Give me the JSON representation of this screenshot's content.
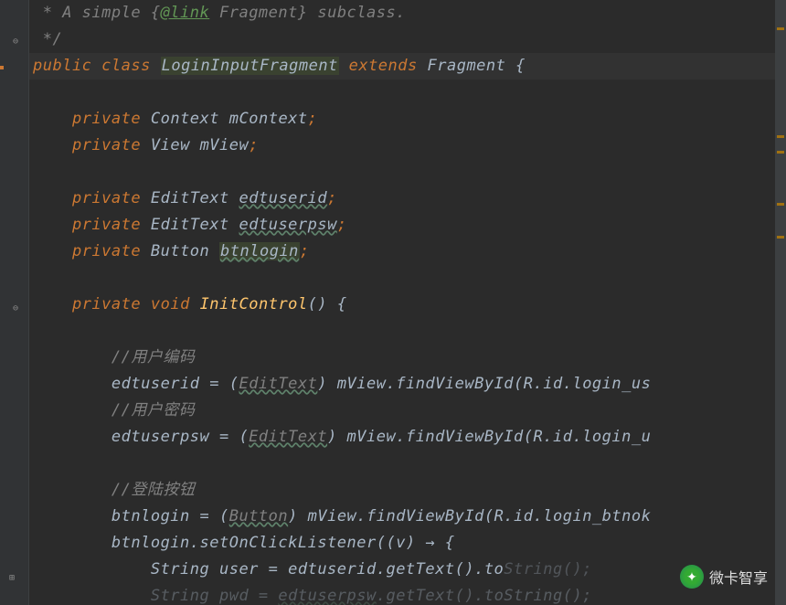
{
  "doc": {
    "line1_pre": " * A simple {",
    "link_tag": "@link",
    "line1_mid": " Fragment",
    "line1_post": "} subclass.",
    "line2": " */"
  },
  "class_decl": {
    "public": "public",
    "class_kw": "class",
    "name": "LoginInputFragment",
    "extends_kw": "extends",
    "parent": "Fragment",
    "brace": " {"
  },
  "fields": {
    "f1": {
      "mod": "private",
      "type": "Context",
      "name": "mContext",
      "semi": ";"
    },
    "f2": {
      "mod": "private",
      "type": "View",
      "name": "mView",
      "semi": ";"
    },
    "f3": {
      "mod": "private",
      "type": "EditText",
      "name": "edtuserid",
      "semi": ";"
    },
    "f4": {
      "mod": "private",
      "type": "EditText",
      "name": "edtuserpsw",
      "semi": ";"
    },
    "f5": {
      "mod": "private",
      "type": "Button",
      "name": "btnlogin",
      "semi": ";"
    }
  },
  "method": {
    "mod": "private",
    "ret": "void",
    "name": "InitControl",
    "parens": "()",
    "brace": " {"
  },
  "body": {
    "c1": "//用户编码",
    "l1_a": "edtuserid = (",
    "l1_cast": "EditText",
    "l1_b": ") mView.findViewById(R.id.",
    "l1_id": "login_us",
    "c2": "//用户密码",
    "l2_a": "edtuserpsw = (",
    "l2_cast": "EditText",
    "l2_b": ") mView.findViewById(R.id.",
    "l2_id": "login_u",
    "c3": "//登陆按钮",
    "l3_a": "btnlogin = (",
    "l3_cast": "Button",
    "l3_b": ") mView.findViewById(R.id.",
    "l3_id": "login_btnok",
    "l4_a": "btnlogin.",
    "l4_m": "setOnClickListener",
    "l4_b": "((v) → {",
    "l5_a": "String user = edtuserid.getText().to",
    "l5_tail": "String();",
    "l6_a": "String pwd = ",
    "l6_b": "edtuserpsw",
    "l6_c": ".getText().toString();"
  },
  "watermark": "微卡智享",
  "stripe": {
    "marks": [
      30,
      148,
      165,
      222,
      258
    ]
  }
}
